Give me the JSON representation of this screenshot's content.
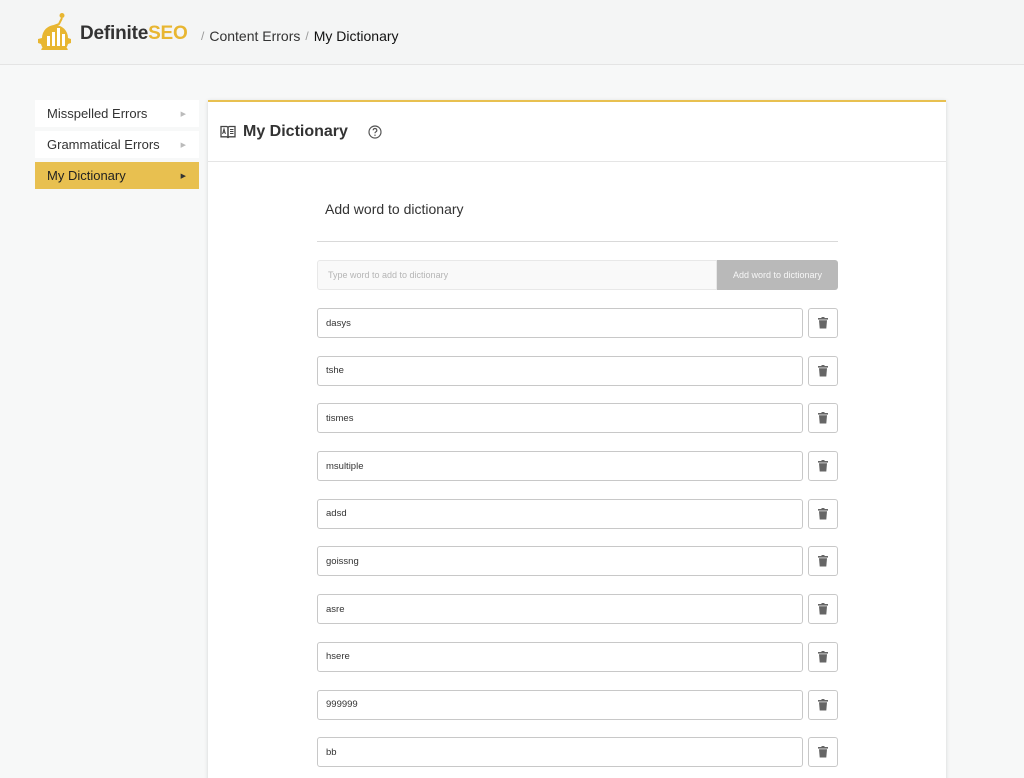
{
  "header": {
    "brand_main": "Definite",
    "brand_accent": "SEO",
    "breadcrumbs": [
      "Content Errors",
      "My Dictionary"
    ],
    "accent_color": "#e8b631"
  },
  "sidebar": {
    "items": [
      {
        "label": "Misspelled Errors",
        "active": false
      },
      {
        "label": "Grammatical Errors",
        "active": false
      },
      {
        "label": "My Dictionary",
        "active": true
      }
    ]
  },
  "panel": {
    "title": "My Dictionary",
    "section_title": "Add word to dictionary",
    "add_placeholder": "Type word to add to dictionary",
    "add_button": "Add word to dictionary"
  },
  "words": [
    "dasys",
    "tshe",
    "tismes",
    "msultiple",
    "adsd",
    "goissng",
    "asre",
    "hsere",
    "999999",
    "bb"
  ],
  "icons": {
    "logo": "gear-chart-logo-icon",
    "panel": "book-icon",
    "help": "question-circle-icon",
    "delete": "trash-icon",
    "nav_arrow": "caret-right-icon"
  }
}
